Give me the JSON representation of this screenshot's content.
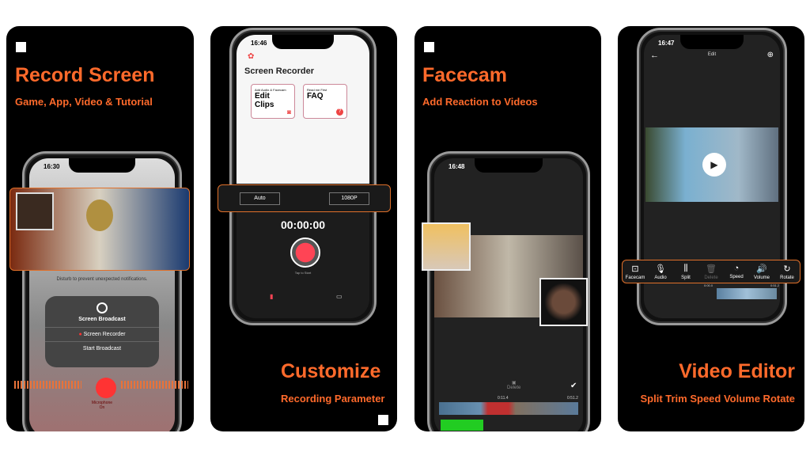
{
  "accent": "#ff6a2b",
  "panel1": {
    "title": "Record Screen",
    "subtitle": "Game, App, Video & Tutorial",
    "time": "16:30",
    "notice": "Disturb to prevent unexpected notifications.",
    "broadcast_title": "Screen Broadcast",
    "app_name": "Screen Recorder",
    "start": "Start Broadcast",
    "mic": "Microphone",
    "mic_state": "On"
  },
  "panel2": {
    "title": "Customize",
    "subtitle": "Recording Parameter",
    "time": "16:46",
    "app_title": "Screen Recorder",
    "card1_small": "Add Audio & Facecam",
    "card1_big": "Edit Clips",
    "card2_small": "Read me First",
    "card2_big": "FAQ",
    "orientation": "Auto",
    "resolution": "1080P",
    "timer": "00:00:00",
    "tap": "Tap to Start"
  },
  "panel3": {
    "title": "Facecam",
    "subtitle": "Add Reaction to Videos",
    "time": "16:48",
    "delete": "Delete",
    "t_start": "0:11.4",
    "t_end": "0:51.2"
  },
  "panel4": {
    "title": "Video Editor",
    "subtitle": "Split Trim Speed Volume Rotate",
    "time": "16:47",
    "header": "Edit",
    "t_start": "0:00.0",
    "t_end": "0:51.2",
    "tools": [
      {
        "label": "Facecam",
        "icon": "facecam-icon",
        "g": "⊡"
      },
      {
        "label": "Audio",
        "icon": "microphone-icon",
        "g": "🎙"
      },
      {
        "label": "Split",
        "icon": "split-icon",
        "g": "⫼"
      },
      {
        "label": "Delete",
        "icon": "trash-icon",
        "g": "🗑"
      },
      {
        "label": "Speed",
        "icon": "speedometer-icon",
        "g": "◔"
      },
      {
        "label": "Volume",
        "icon": "volume-icon",
        "g": "🔊"
      },
      {
        "label": "Rotate",
        "icon": "rotate-icon",
        "g": "↻"
      }
    ]
  }
}
